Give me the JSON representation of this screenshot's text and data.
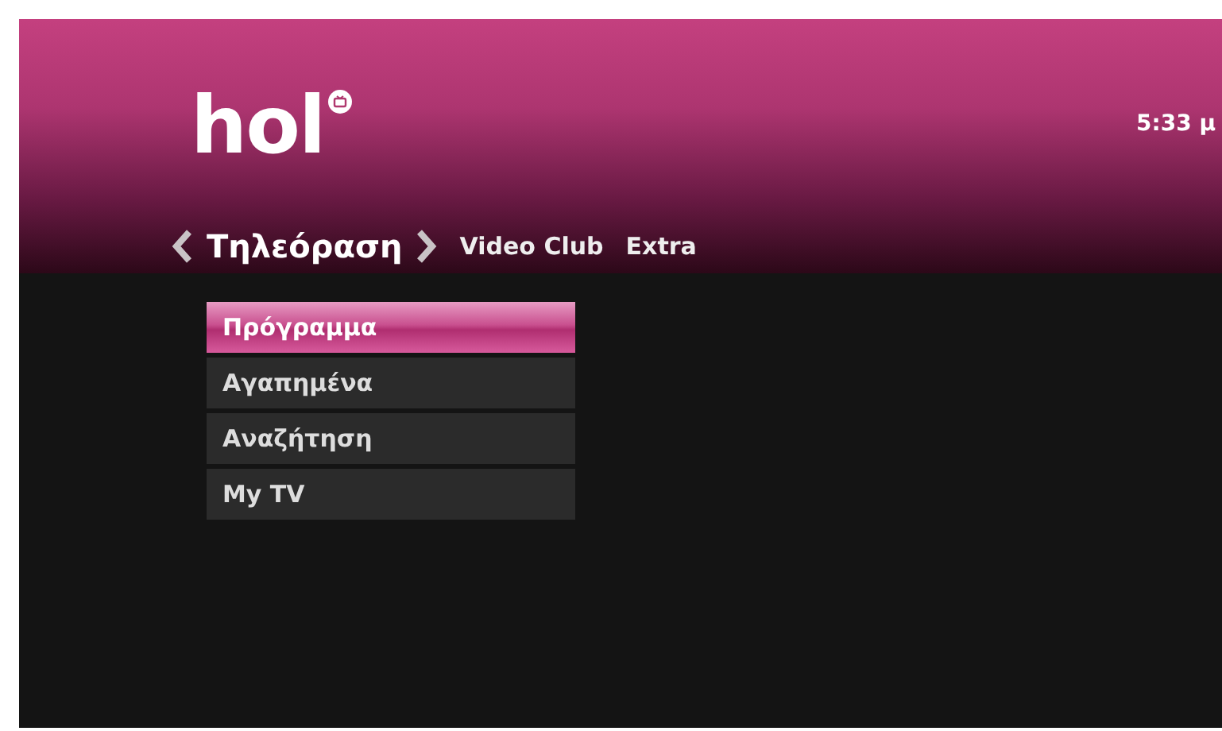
{
  "header": {
    "logo": "hol",
    "time": "5:33 μ"
  },
  "tabs": [
    {
      "label": "Τηλεόραση",
      "selected": true
    },
    {
      "label": "Video Club",
      "selected": false
    },
    {
      "label": "Extra",
      "selected": false
    }
  ],
  "menu": [
    {
      "label": "Πρόγραμμα",
      "selected": true
    },
    {
      "label": "Αγαπημένα",
      "selected": false
    },
    {
      "label": "Αναζήτηση",
      "selected": false
    },
    {
      "label": "My TV",
      "selected": false
    }
  ]
}
